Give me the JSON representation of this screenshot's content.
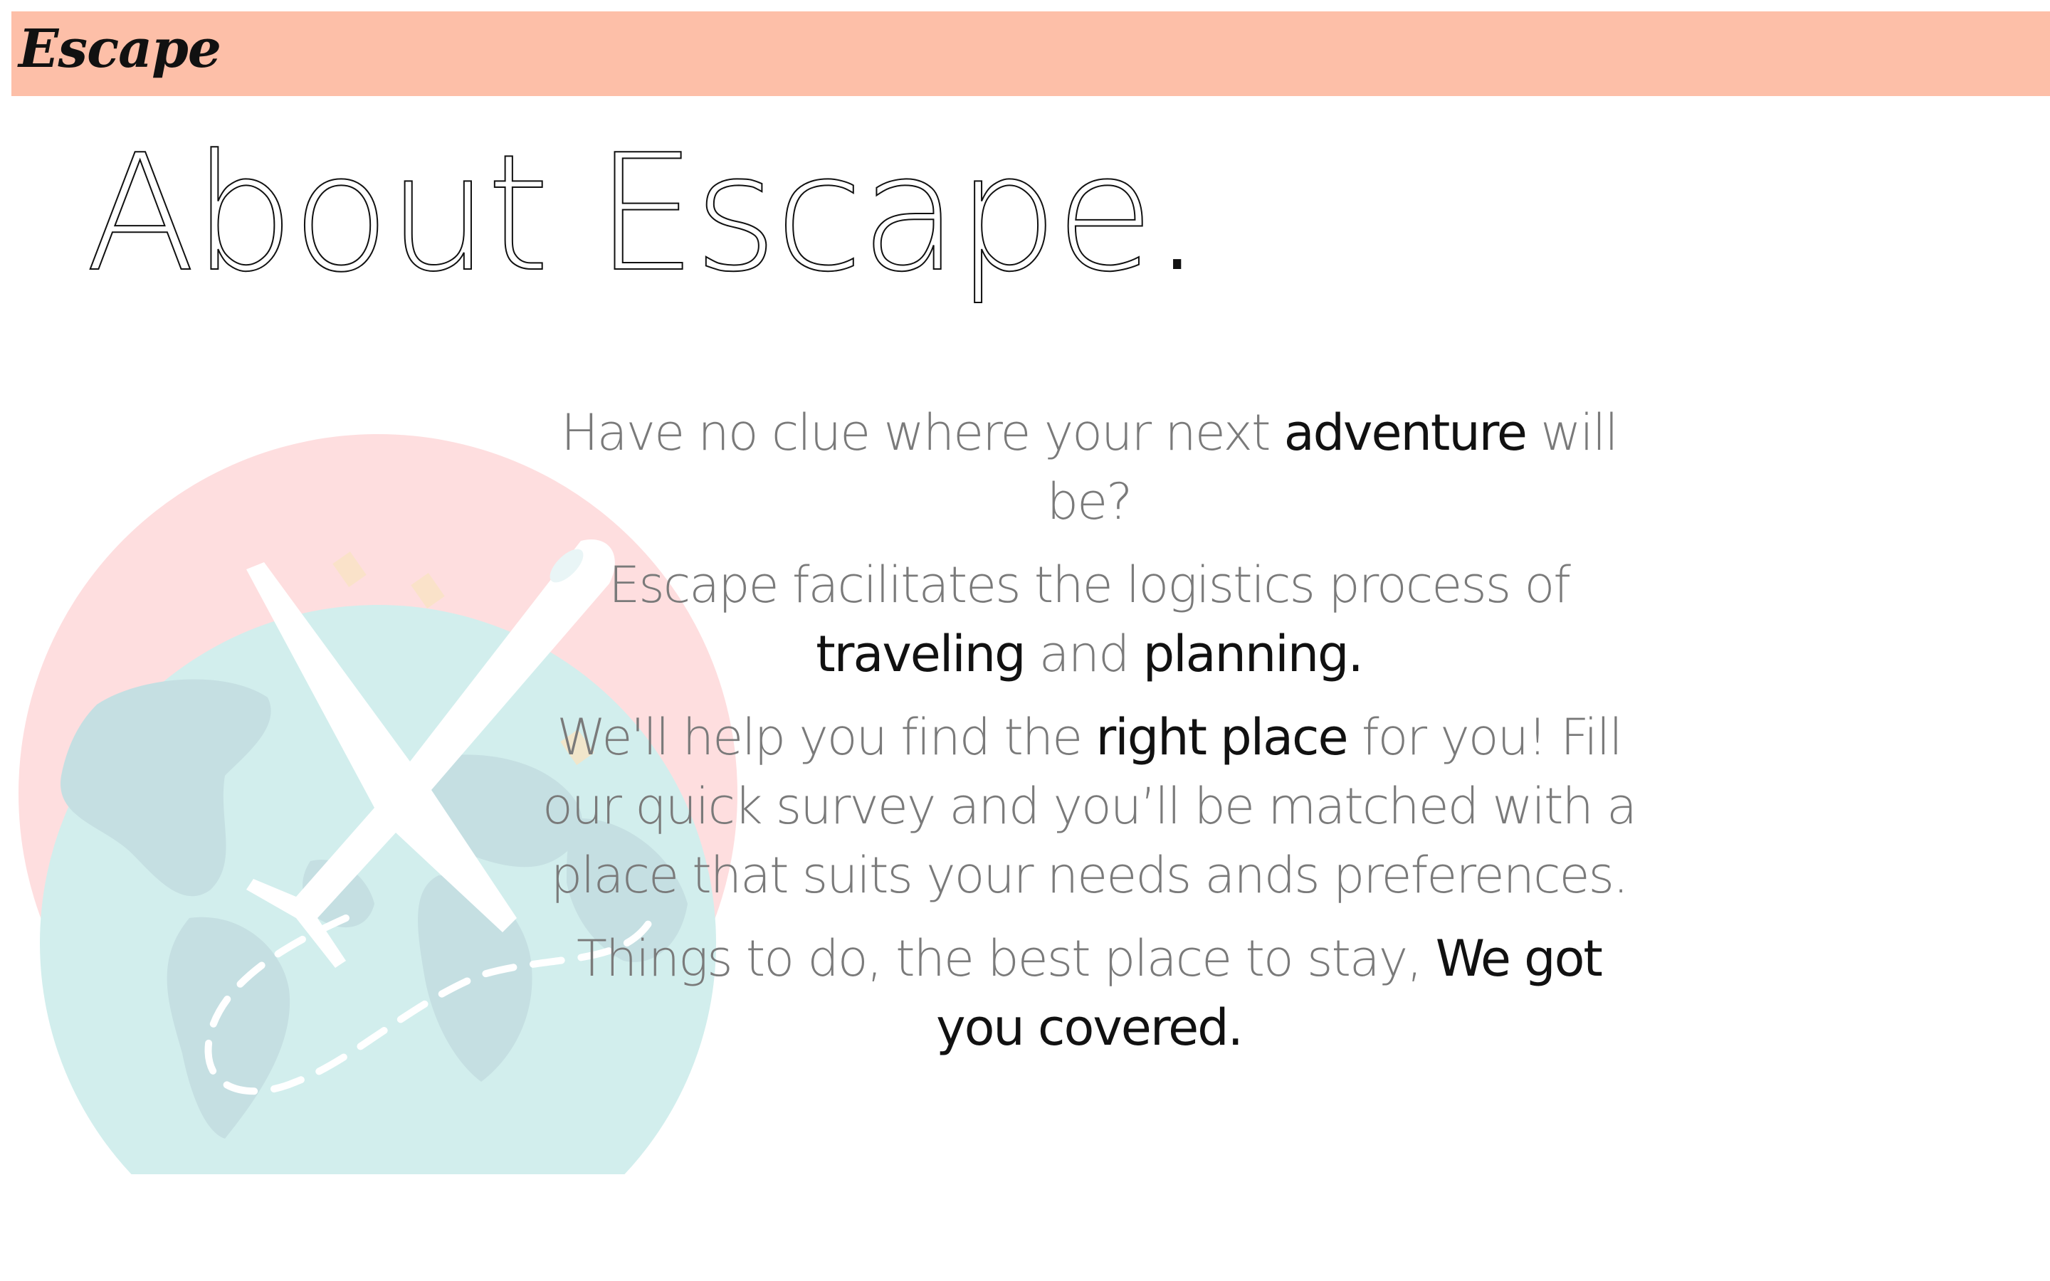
{
  "header": {
    "brand": "Escape",
    "bar_color": "#fdbfa8"
  },
  "page": {
    "title": "About Escape",
    "title_dot": "."
  },
  "about": {
    "p1": {
      "a": "Have no clue where your next ",
      "b": "adventure",
      "c": " will be?"
    },
    "p2": {
      "a": "Escape facilitates the logistics process of ",
      "b": "traveling",
      "c": " and ",
      "d": "planning",
      "e": "."
    },
    "p3": {
      "a": "We'll help you find the ",
      "b": "right place",
      "c": " for you! Fill our quick survey and you’ll be matched with a place that suits your needs ands preferences."
    },
    "p4": {
      "a": "Things to do, the best place to stay, ",
      "b": "We got you covered."
    }
  },
  "icons": {
    "illustration": "globe-airplane-illustration"
  }
}
